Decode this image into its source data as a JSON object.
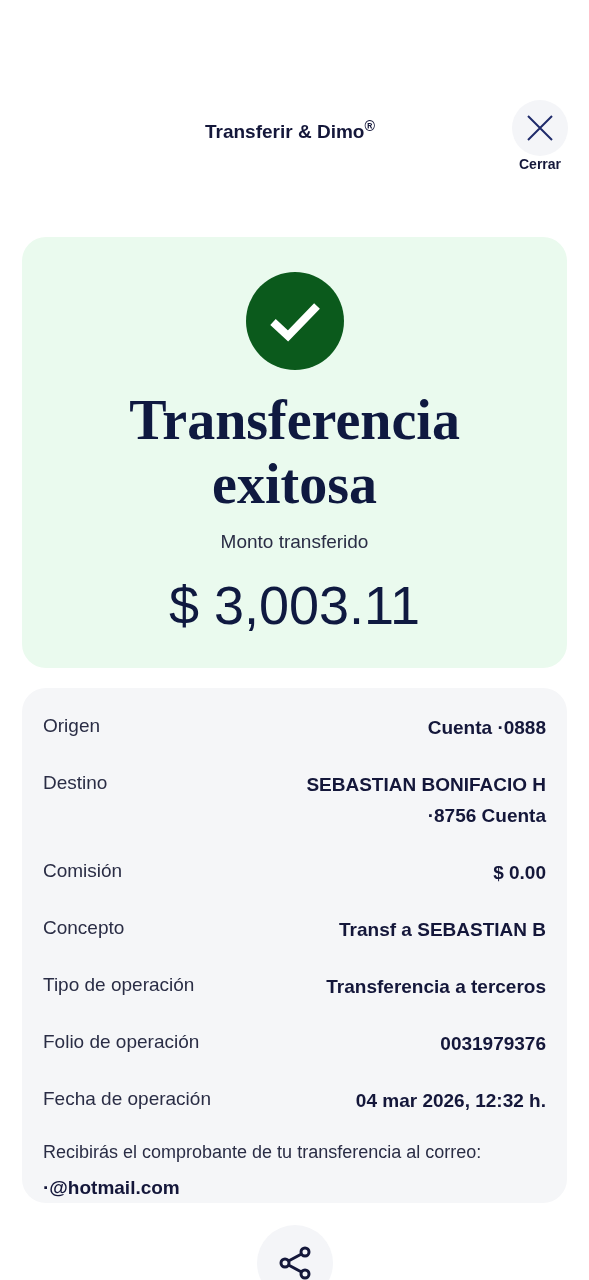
{
  "header": {
    "title": "Transferir & Dimo$^{®}$",
    "close_label": "Cerrar"
  },
  "result": {
    "title": "Transferencia exitosa",
    "amount_label": "Monto transferido",
    "amount": "$ 3,003.11"
  },
  "details": [
    {
      "label": "Origen",
      "value": "Cuenta ·0888"
    },
    {
      "label": "Destino",
      "value": "SEBASTIAN BONIFACIO H ·8756 Cuenta"
    },
    {
      "label": "Comisión",
      "value": "$ 0.00"
    },
    {
      "label": "Concepto",
      "value": "Transf a SEBASTIAN B"
    },
    {
      "label": "Tipo de operación",
      "value": "Transferencia a terceros"
    },
    {
      "label": "Folio de operación",
      "value": "0031979376"
    },
    {
      "label": "Fecha de operación",
      "value": "04 mar 2026, 12:32 h."
    }
  ],
  "receipt_note": "Recibirás el comprobante de tu transferencia al correo:",
  "email": "·@hotmail.com"
}
